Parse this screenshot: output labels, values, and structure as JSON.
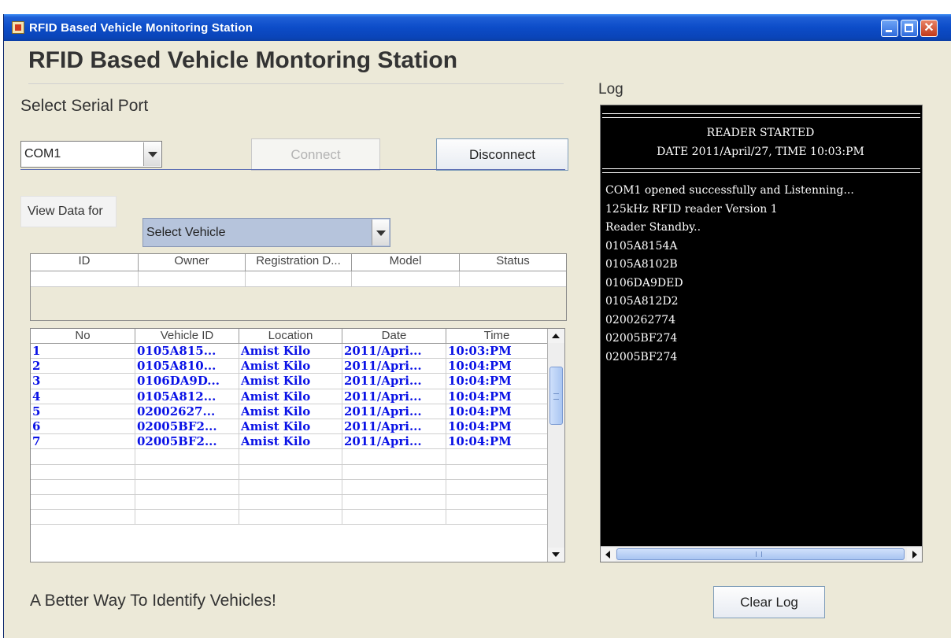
{
  "window": {
    "title": "RFID Based Vehicle Monitoring Station",
    "controls": [
      "minimize-icon",
      "maximize-icon",
      "close-icon"
    ],
    "close_glyph": "✕"
  },
  "header": {
    "title": "RFID Based Vehicle Montoring Station",
    "serial_label": "Select Serial Port"
  },
  "serial": {
    "port_value": "COM1",
    "connect_label": "Connect",
    "disconnect_label": "Disconnect"
  },
  "view": {
    "label": "View Data for",
    "vehicle_value": "Select Vehicle"
  },
  "vehicle_table": {
    "columns": [
      "ID",
      "Owner",
      "Registration D...",
      "Model",
      "Status"
    ]
  },
  "log_table": {
    "columns": [
      "No",
      "Vehicle ID",
      "Location",
      "Date",
      "Time"
    ],
    "rows": [
      [
        "1",
        "0105A815...",
        "Amist Kilo",
        "2011/Apri...",
        "10:03:PM"
      ],
      [
        "2",
        "0105A810...",
        "Amist Kilo",
        "2011/Apri...",
        "10:04:PM"
      ],
      [
        "3",
        "0106DA9D...",
        "Amist Kilo",
        "2011/Apri...",
        "10:04:PM"
      ],
      [
        "4",
        "0105A812...",
        "Amist Kilo",
        "2011/Apri...",
        "10:04:PM"
      ],
      [
        "5",
        "02002627...",
        "Amist Kilo",
        "2011/Apri...",
        "10:04:PM"
      ],
      [
        "6",
        "02005BF2...",
        "Amist Kilo",
        "2011/Apri...",
        "10:04:PM"
      ],
      [
        "7",
        "02005BF2...",
        "Amist Kilo",
        "2011/Apri...",
        "10:04:PM"
      ]
    ],
    "empty_rows": 5
  },
  "footer": {
    "tagline": "A Better Way To Identify Vehicles!",
    "clear_log_label": "Clear Log"
  },
  "log": {
    "label": "Log",
    "header_line1": "READER STARTED",
    "header_line2": "DATE 2011/April/27, TIME 10:03:PM",
    "lines": [
      "COM1 opened successfully and Listenning...",
      "125kHz RFID reader Version 1",
      "Reader Standby..",
      "0105A8154A",
      "0105A8102B",
      "0106DA9DED",
      "0105A812D2",
      "0200262774",
      "02005BF274",
      "02005BF274"
    ]
  }
}
